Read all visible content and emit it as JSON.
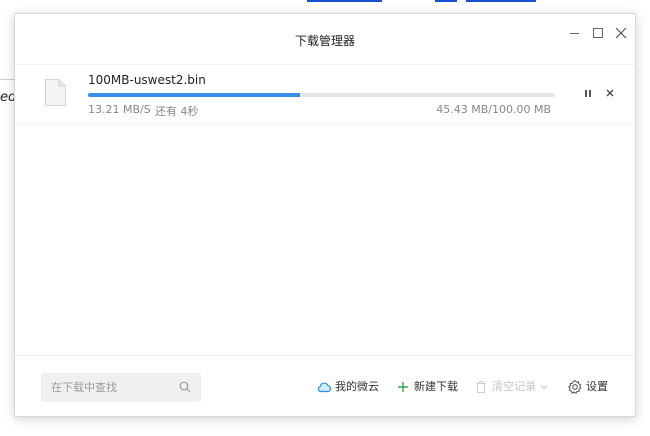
{
  "dialog": {
    "title": "下载管理器"
  },
  "background": {
    "partial_text": "ed"
  },
  "download": {
    "file_name": "100MB-uswest2.bin",
    "speed": "13.21 MB/S",
    "remaining": "还有 4秒",
    "size_progress": "45.43 MB/100.00 MB",
    "progress_fraction": 0.4543,
    "progress_color": "#3a8ee6"
  },
  "footer": {
    "search_placeholder": "在下载中查找",
    "cloud_label": "我的微云",
    "new_download_label": "新建下载",
    "clear_label": "清空记录",
    "settings_label": "设置"
  },
  "colors": {
    "accent": "#3a8ee6",
    "new_download_plus": "#2fa84f",
    "disabled": "#c8c8c8"
  }
}
